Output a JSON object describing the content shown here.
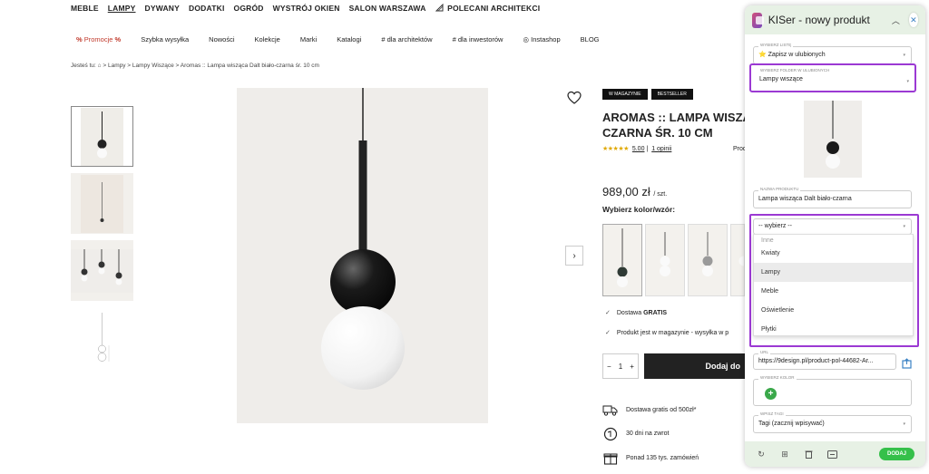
{
  "site": {
    "topnav": [
      "MEBLE",
      "LAMPY",
      "DYWANY",
      "DODATKI",
      "OGRÓD",
      "WYSTRÓJ OKIEN",
      "SALON WARSZAWA",
      "POLECANI ARCHITEKCI"
    ],
    "topnav_active": "LAMPY",
    "subnav": {
      "promo": "Promocje",
      "promo_mark": "%",
      "items": [
        "Szybka wysyłka",
        "Nowości",
        "Kolekcje",
        "Marki",
        "Katalogi",
        "# dla architektów",
        "# dla inwestorów",
        "Instashop",
        "BLOG"
      ]
    },
    "breadcrumb": "Jesteś tu: ⌂ > Lampy > Lampy Wiszące > Aromas :: Lampa wisząca Dalt biało-czarna śr. 10 cm"
  },
  "product": {
    "badges": [
      "W MAGAZYNIE",
      "BESTSELLER"
    ],
    "title_line1": "AROMAS :: LAMPA WISZĄC",
    "title_line2": "CZARNA ŚR. 10 CM",
    "stars": "★★★★★",
    "rating": "5.00",
    "reviews": "1 opinii",
    "producer_label": "Prod",
    "price": "989,00 zł",
    "price_unit": "/ szt.",
    "choose_label": "Wybierz kolor/wzór:",
    "delivery_label": "Dostawa",
    "delivery_value": "GRATIS",
    "stock_info": "Produkt jest w magazynie - wysyłka w p",
    "qty_minus": "−",
    "qty": "1",
    "qty_plus": "+",
    "add_to_cart": "Dodaj do",
    "perks": [
      "Dostawa gratis od 500zł*",
      "30 dni na zwrot",
      "Ponad 135 tys. zamówień"
    ],
    "next_arrow": "›"
  },
  "panel": {
    "title": "KISer - nowy produkt",
    "list_label": "WYBIERZ LISTĘ",
    "list_value": "⭐ Zapisz w ulubionych",
    "folder_label": "WYBIERZ FOLDER W ULUBIONYCH",
    "folder_value": "Lampy wiszące",
    "name_label": "NAZWA PRODUKTU",
    "name_value": "Lampa wisząca Dalt biało-czarna",
    "category_value": "-- wybierz --",
    "category_options": [
      "Inne",
      "Kwiaty",
      "Lampy",
      "Meble",
      "Oświetlenie",
      "Płytki"
    ],
    "category_hover": "Lampy",
    "url_label": "URL",
    "url_value": "https://9design.pl/product-pol-44682-Ar...",
    "color_label": "WYBIERZ KOLOR",
    "tags_label": "WPISZ TAGI",
    "tags_value": "Tagi (zacznij wpisywać)",
    "add_button": "DODAJ"
  },
  "colors": {
    "highlight": "#9b39d3",
    "panel_header": "#e7f1e5",
    "add_green": "#35c04a",
    "star": "#e0a800"
  }
}
